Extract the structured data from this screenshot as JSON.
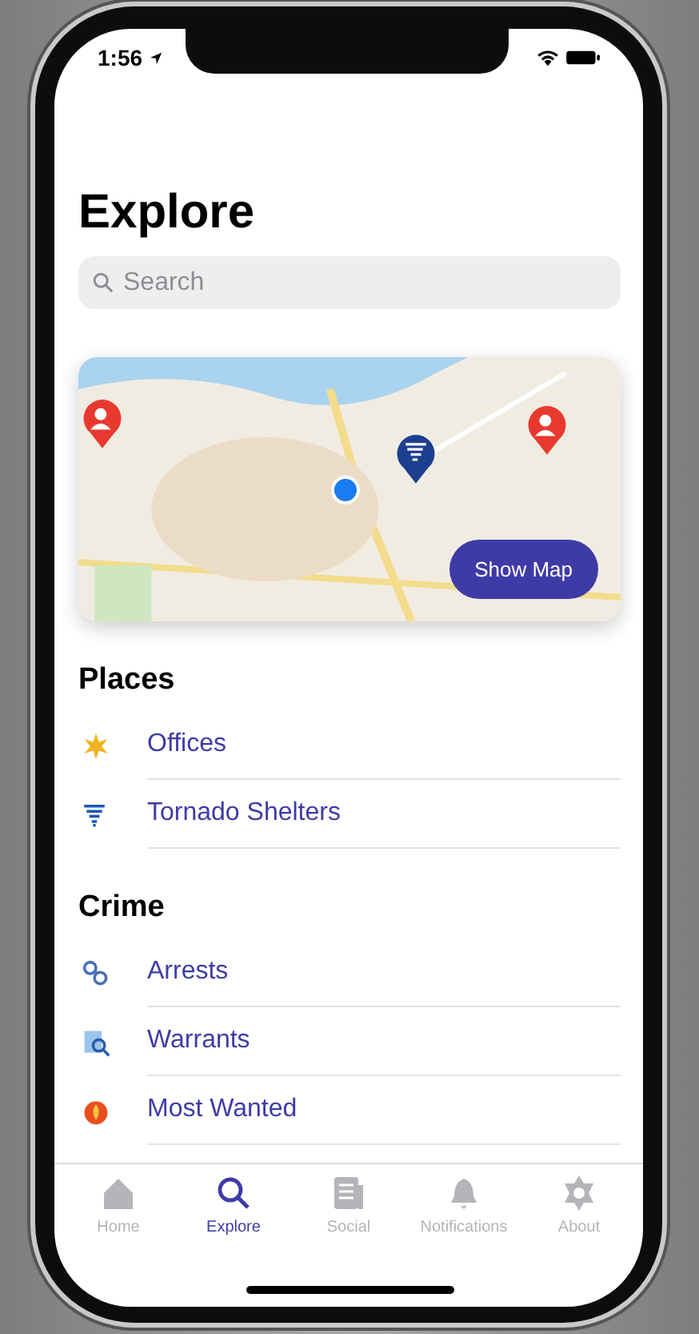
{
  "status_bar": {
    "time": "1:56"
  },
  "title": "Explore",
  "search": {
    "placeholder": "Search"
  },
  "map": {
    "button": "Show Map"
  },
  "sections": [
    {
      "title": "Places",
      "items": [
        {
          "label": "Offices"
        },
        {
          "label": "Tornado Shelters"
        }
      ]
    },
    {
      "title": "Crime",
      "items": [
        {
          "label": "Arrests"
        },
        {
          "label": "Warrants"
        },
        {
          "label": "Most Wanted"
        }
      ]
    }
  ],
  "tabs": [
    {
      "label": "Home",
      "selected": false
    },
    {
      "label": "Explore",
      "selected": true
    },
    {
      "label": "Social",
      "selected": false
    },
    {
      "label": "Notifications",
      "selected": false
    },
    {
      "label": "About",
      "selected": false
    }
  ]
}
